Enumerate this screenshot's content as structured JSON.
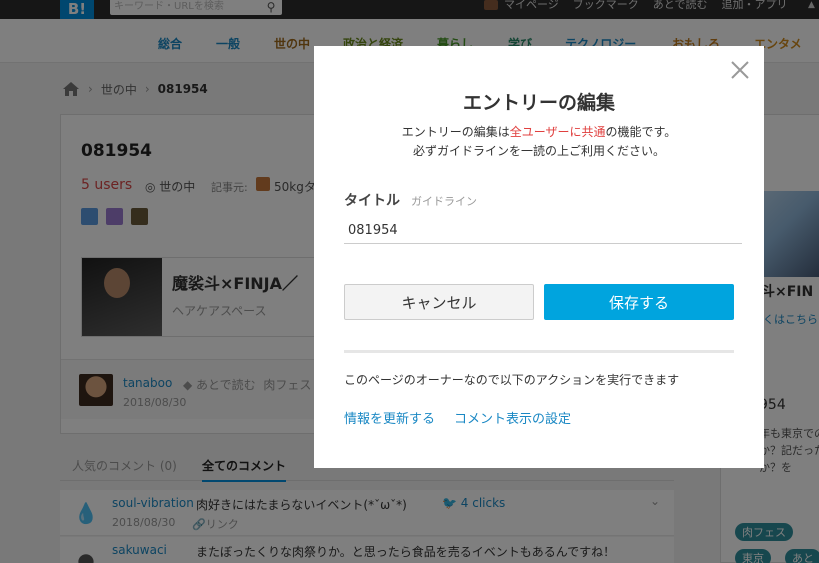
{
  "topbar": {
    "logo": "B!",
    "search_placeholder": "キーワード・URLを検索",
    "links": [
      "マイページ",
      "ブックマーク",
      "あとで読む",
      "追加・アプリ"
    ]
  },
  "categories": [
    {
      "label": "総合",
      "color": "#1a88c4"
    },
    {
      "label": "一般",
      "color": "#1a88c4"
    },
    {
      "label": "世の中",
      "color": "#a06a1c"
    },
    {
      "label": "政治と経済",
      "color": "#6a8a1c"
    },
    {
      "label": "暮らし",
      "color": "#4a9a2a"
    },
    {
      "label": "学び",
      "color": "#2a8a6a"
    },
    {
      "label": "テクノロジー",
      "color": "#1a88c4"
    },
    {
      "label": "おもしろ",
      "color": "#c07a1c"
    },
    {
      "label": "エンタメ",
      "color": "#d08a1c"
    }
  ],
  "breadcrumb": {
    "sep": "›",
    "category": "世の中",
    "current": "081954"
  },
  "entry": {
    "title": "081954",
    "users": "5 users",
    "category": "世の中",
    "source_label": "記事元:",
    "source_name": "50kgタ",
    "preview_title": "魔裟斗×FINJA／",
    "preview_desc": "ヘアケアスペース"
  },
  "featured_comment": {
    "user": "tanaboo",
    "later": "あとで読む",
    "tag": "肉フェス",
    "date": "2018/08/30"
  },
  "comment_tabs": {
    "popular": "人気のコメント (0)",
    "all": "全てのコメント"
  },
  "comments": [
    {
      "user": "soul-vibration",
      "text": "肉好きにはたまらないイベント(*ˇωˇ*)",
      "clicks": "4 clicks",
      "date": "2018/08/30",
      "link": "リンク"
    },
    {
      "user": "sakuwaci",
      "text": "またぼったくりな肉祭りか。と思ったら食品を売るイベントもあるんですね！"
    }
  ],
  "right_column": {
    "title": "斗×FIN",
    "link": "くはこちら",
    "number": "954",
    "text": "年も東京でのか？記だったか？を",
    "tags": [
      "肉フェス",
      "東京",
      "あと"
    ]
  },
  "modal": {
    "title": "エントリーの編集",
    "desc_line1_pre": "エントリーの編集は",
    "desc_line1_em": "全ユーザーに共通",
    "desc_line1_post": "の機能です。",
    "desc_line2": "必ずガイドラインを一読の上ご利用ください。",
    "field_label": "タイトル",
    "guideline_link": "ガイドライン",
    "title_value": "081954",
    "cancel_label": "キャンセル",
    "save_label": "保存する",
    "owner_note": "このページのオーナーなので以下のアクションを実行できます",
    "action_update": "情報を更新する",
    "action_comment_settings": "コメント表示の設定"
  }
}
